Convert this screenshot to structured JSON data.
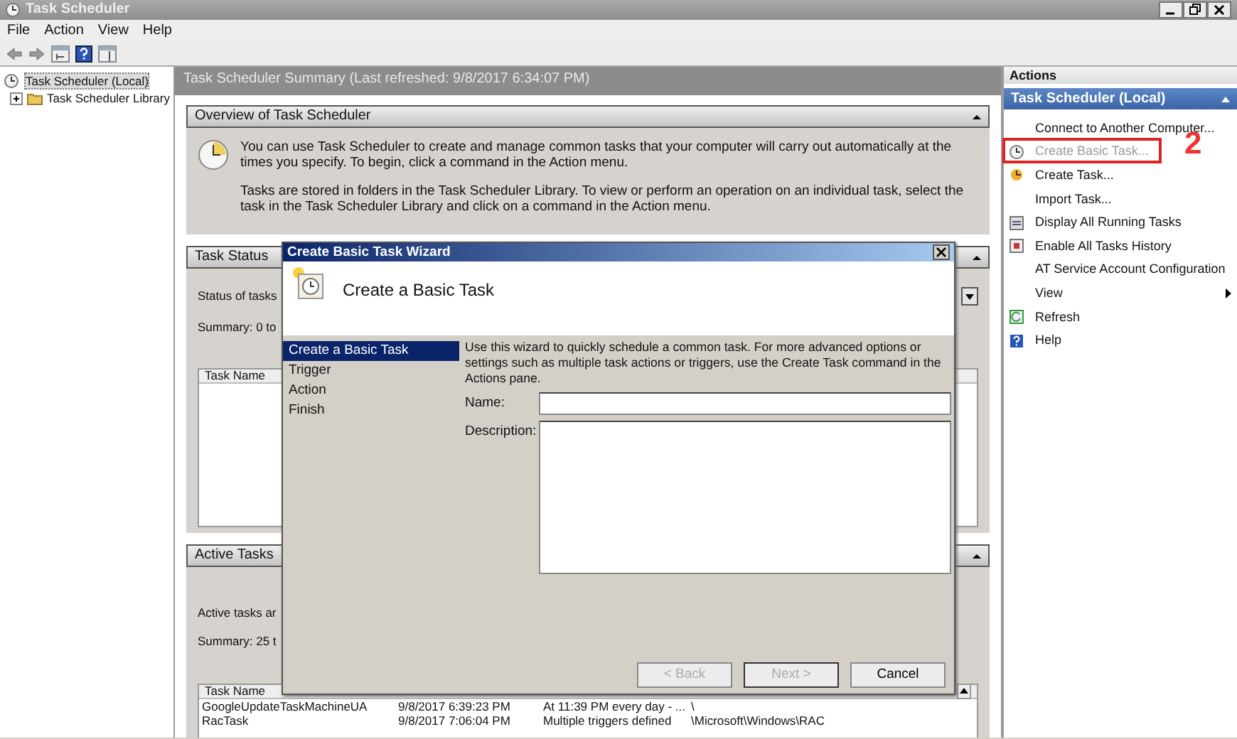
{
  "window": {
    "title": "Task Scheduler"
  },
  "menu": [
    "File",
    "Action",
    "View",
    "Help"
  ],
  "tree": [
    {
      "label": "Task Scheduler (Local)",
      "selected": true,
      "children": [
        {
          "label": "Task Scheduler Library",
          "selected": false,
          "expanded": false
        }
      ]
    }
  ],
  "summary": {
    "title": "Task Scheduler Summary (Last refreshed: 9/8/2017 6:34:07 PM)"
  },
  "sections": [
    {
      "kind": "overview",
      "title": "Overview of Task Scheduler",
      "paragraphs": [
        "You can use Task Scheduler to create and manage common tasks that your computer will carry out automatically at the times you specify. To begin, click a command in the Action menu.",
        "Tasks are stored in folders in the Task Scheduler Library. To view or perform an operation on an individual task, select the task in the Task Scheduler Library and click on a command in the Action menu."
      ]
    },
    {
      "kind": "status",
      "title": "Task Status",
      "lines": [
        "Status of tasks",
        "Summary: 0 to"
      ],
      "table": {
        "columns": [
          "Task Name"
        ]
      }
    },
    {
      "kind": "active",
      "title": "Active Tasks",
      "lines": [
        "Active tasks ar",
        "Summary: 25 t"
      ],
      "table": {
        "columns": [
          "Task Name"
        ],
        "rows": [
          [
            "GoogleUpdateTaskMachineUA",
            "9/8/2017 6:39:23 PM",
            "At 11:39 PM every day - ...",
            "\\"
          ],
          [
            "RacTask",
            "9/8/2017 7:06:04 PM",
            "Multiple triggers defined",
            "\\Microsoft\\Windows\\RAC"
          ]
        ]
      }
    }
  ],
  "actions": {
    "title": "Actions",
    "group": "Task Scheduler (Local)",
    "items": [
      {
        "label": "Connect to Another Computer...",
        "kind": "command",
        "disabled": false,
        "highlighted": false
      },
      {
        "label": "Create Basic Task...",
        "kind": "command",
        "disabled": true,
        "highlighted": true
      },
      {
        "label": "Create Task...",
        "kind": "command",
        "disabled": false,
        "highlighted": false
      },
      {
        "label": "Import Task...",
        "kind": "command",
        "disabled": false,
        "highlighted": false
      },
      {
        "label": "Display All Running Tasks",
        "kind": "command",
        "disabled": false,
        "highlighted": false
      },
      {
        "label": "Enable All Tasks History",
        "kind": "command",
        "disabled": false,
        "highlighted": false
      },
      {
        "label": "AT Service Account Configuration",
        "kind": "command",
        "disabled": false,
        "highlighted": false
      },
      {
        "label": "View",
        "kind": "submenu",
        "disabled": false,
        "highlighted": false
      },
      {
        "label": "Refresh",
        "kind": "command",
        "disabled": false,
        "highlighted": false
      },
      {
        "label": "Help",
        "kind": "command",
        "disabled": false,
        "highlighted": false
      }
    ]
  },
  "annotation": {
    "label": "2"
  },
  "wizard": {
    "title": "Create Basic Task Wizard",
    "heading": "Create a Basic Task",
    "steps": [
      {
        "label": "Create a Basic Task",
        "selected": true
      },
      {
        "label": "Trigger",
        "selected": false
      },
      {
        "label": "Action",
        "selected": false
      },
      {
        "label": "Finish",
        "selected": false
      }
    ],
    "intro": "Use this wizard to quickly schedule a common task. For more advanced options or settings such as multiple task actions or triggers, use the Create Task command in the Actions pane.",
    "fields": [
      {
        "label": "Name:",
        "kind": "text"
      },
      {
        "label": "Description:",
        "kind": "textarea"
      }
    ],
    "buttons": [
      {
        "label": "< Back",
        "disabled": true
      },
      {
        "label": "Next >",
        "disabled": true
      },
      {
        "label": "Cancel",
        "disabled": false
      }
    ]
  }
}
